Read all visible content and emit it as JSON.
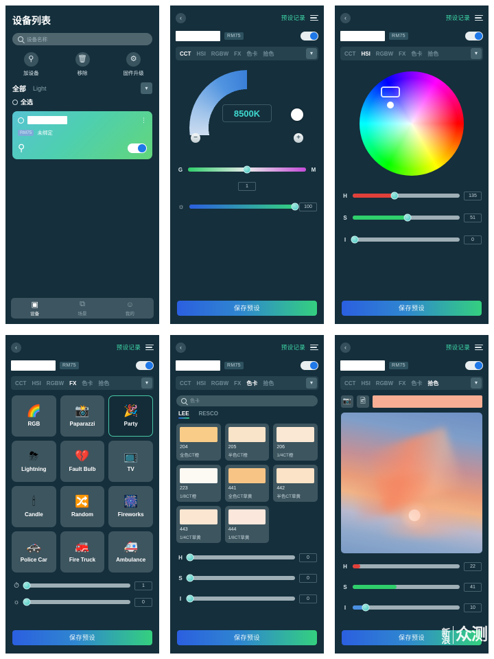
{
  "app": {
    "accent_green": "#3fd9a8",
    "accent_blue": "#1e78e8",
    "panel_bg": "#152f3c"
  },
  "device_list": {
    "title": "设备列表",
    "search": {
      "placeholder": "设备名称",
      "icon": "search-icon"
    },
    "actions": [
      {
        "label": "加设备",
        "icon": "bulb-add-icon",
        "glyph": "♀"
      },
      {
        "label": "移除",
        "icon": "trash-icon",
        "glyph": "Ὕ1"
      },
      {
        "label": "固件升级",
        "icon": "firmware-upgrade-icon",
        "glyph": "⊙"
      }
    ],
    "filters": {
      "all": "全部",
      "type": "Light",
      "chevron": "chevron-down-icon"
    },
    "select_all": "全选",
    "device_card": {
      "name": "",
      "badge": "RM75",
      "status": "未绑定",
      "power_on": true
    },
    "bottom_nav": [
      {
        "label": "设备",
        "icon": "device-icon",
        "glyph": "▣",
        "active": true
      },
      {
        "label": "场景",
        "icon": "scene-icon",
        "glyph": "⧉",
        "active": false
      },
      {
        "label": "我的",
        "icon": "profile-icon",
        "glyph": "☺",
        "active": false
      }
    ]
  },
  "header": {
    "back": "‹",
    "preset_records": "预设记录",
    "menu": "hamburger-icon",
    "device_badge": "RM75",
    "power_on": true
  },
  "tabs": {
    "items": [
      "CCT",
      "HSI",
      "RGBW",
      "FX",
      "色卡",
      "拾色"
    ],
    "chevron": "chevron-down-icon"
  },
  "save_button": "保存预设",
  "cct_panel": {
    "active_tab": "CCT",
    "value": "8500K",
    "minus": "−",
    "plus": "+",
    "gm_slider": {
      "left_label": "G",
      "right_label": "M",
      "value": "1",
      "percent": 50
    },
    "brightness_slider": {
      "icon": "brightness-icon",
      "value": "100",
      "percent": 100
    }
  },
  "hsi_panel": {
    "active_tab": "HSI",
    "wheel_marker": {
      "x_percent": 30,
      "y_percent": 32
    },
    "sliders": [
      {
        "label": "H",
        "value": "135",
        "percent": 39,
        "fill": "#e0403a"
      },
      {
        "label": "S",
        "value": "51",
        "percent": 51,
        "fill": "#2fcf6b"
      },
      {
        "label": "I",
        "value": "0",
        "percent": 0,
        "fill": "#4a90e2"
      }
    ]
  },
  "fx_panel": {
    "active_tab": "FX",
    "effects": [
      {
        "label": "RGB",
        "icon": "rgb-circles-icon",
        "glyph": "🌈",
        "selected": false
      },
      {
        "label": "Paparazzi",
        "icon": "camera-flash-icon",
        "glyph": "📸",
        "selected": false
      },
      {
        "label": "Party",
        "icon": "party-popper-icon",
        "glyph": "🎉",
        "selected": true
      },
      {
        "label": "Lightning",
        "icon": "cloud-lightning-icon",
        "glyph": "⛈",
        "selected": false
      },
      {
        "label": "Fault Bulb",
        "icon": "broken-heart-icon",
        "glyph": "💔",
        "selected": false
      },
      {
        "label": "TV",
        "icon": "tv-icon",
        "glyph": "📺",
        "selected": false
      },
      {
        "label": "Candle",
        "icon": "candle-icon",
        "glyph": "🕯",
        "selected": false
      },
      {
        "label": "Random",
        "icon": "shuffle-icon",
        "glyph": "🔀",
        "selected": false
      },
      {
        "label": "Fireworks",
        "icon": "fireworks-icon",
        "glyph": "🎆",
        "selected": false
      },
      {
        "label": "Police Car",
        "icon": "police-car-icon",
        "glyph": "🚓",
        "selected": false
      },
      {
        "label": "Fire Truck",
        "icon": "fire-truck-icon",
        "glyph": "🚒",
        "selected": false
      },
      {
        "label": "Ambulance",
        "icon": "ambulance-icon",
        "glyph": "🚑",
        "selected": false
      }
    ],
    "speed_slider": {
      "icon": "speed-icon",
      "value": "1",
      "percent": 2
    },
    "brightness_slider": {
      "icon": "brightness-icon",
      "value": "0",
      "percent": 2
    }
  },
  "color_card_panel": {
    "active_tab": "色卡",
    "search_placeholder": "色卡",
    "brands": [
      {
        "label": "LEE",
        "active": true
      },
      {
        "label": "RESCO",
        "active": false
      }
    ],
    "cards": [
      {
        "code": "204",
        "desc": "全色CT橙",
        "color": "#f9cc88"
      },
      {
        "code": "205",
        "desc": "半色CT橙",
        "color": "#fae4c9"
      },
      {
        "code": "206",
        "desc": "1/4CT橙",
        "color": "#fbe8d4"
      },
      {
        "code": "223",
        "desc": "1/8CT橙",
        "color": "#fdfaf4"
      },
      {
        "code": "441",
        "desc": "全色CT草黄",
        "color": "#f7c485"
      },
      {
        "code": "442",
        "desc": "半色CT草黄",
        "color": "#fae3c6"
      },
      {
        "code": "443",
        "desc": "1/4CT草黄",
        "color": "#fbe6d2"
      },
      {
        "code": "444",
        "desc": "1/8CT草黄",
        "color": "#fbe7dc"
      }
    ],
    "sliders": [
      {
        "label": "H",
        "value": "0",
        "percent": 0,
        "fill": "#4a90e2"
      },
      {
        "label": "S",
        "value": "0",
        "percent": 0,
        "fill": "#2fcf6b"
      },
      {
        "label": "I",
        "value": "0",
        "percent": 0,
        "fill": "#4a90e2"
      }
    ]
  },
  "picker_panel": {
    "active_tab": "拾色",
    "camera_icon": "camera-icon",
    "gallery_icon": "gallery-icon",
    "preview_color": "#f7ae94",
    "photo_alt": "sunset-sky-photo",
    "sliders": [
      {
        "label": "H",
        "value": "22",
        "percent": 7,
        "fill": "#e0403a"
      },
      {
        "label": "S",
        "value": "41",
        "percent": 41,
        "fill": "#2fcf6b"
      },
      {
        "label": "I",
        "value": "10",
        "percent": 12,
        "fill": "#4a90e2"
      }
    ]
  },
  "watermark": {
    "sina": "新浪",
    "zhongce": "众测"
  }
}
